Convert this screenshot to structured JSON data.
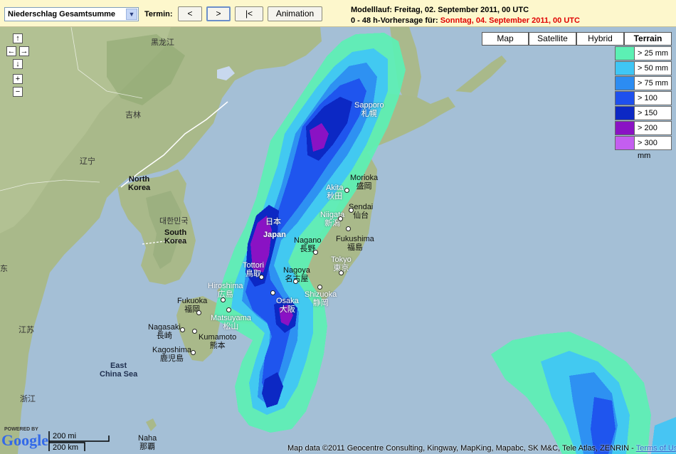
{
  "toolbar": {
    "parameter": "Niederschlag Gesamtsumme",
    "termin_label": "Termin:",
    "prev_label": "<",
    "next_label": ">",
    "first_label": "|<",
    "animation_label": "Animation",
    "modelllauf": "Modelllauf: Freitag, 02. September 2011, 00 UTC",
    "forecast_prefix": "0 - 48 h-Vorhersage für: ",
    "forecast_date": "Sonntag, 04. September 2011, 00 UTC"
  },
  "map_types": [
    "Map",
    "Satellite",
    "Hybrid",
    "Terrain"
  ],
  "active_map_type": "Terrain",
  "legend": [
    {
      "label": "> 25 mm",
      "color": "#5cf0b4"
    },
    {
      "label": "> 50 mm",
      "color": "#3fc6f5"
    },
    {
      "label": "> 75 mm",
      "color": "#2c8cf2"
    },
    {
      "label": "> 100 mm",
      "color": "#1e50ee"
    },
    {
      "label": "> 150 mm",
      "color": "#0c28c4"
    },
    {
      "label": "> 200 mm",
      "color": "#8a12c4"
    },
    {
      "label": "> 300 mm",
      "color": "#c45ef0"
    }
  ],
  "nav": {
    "up": "↑",
    "left": "←",
    "right": "→",
    "down": "↓",
    "zoom_in": "+",
    "zoom_out": "−"
  },
  "labels": {
    "heilongjiang": "黑龙江",
    "jilin": "吉林",
    "liaoning": "辽宁",
    "north_korea_1": "North",
    "north_korea_2": "Korea",
    "south_korea_native": "대한민국",
    "south_korea_1": "South",
    "south_korea_2": "Korea",
    "japan_native": "日本",
    "japan": "Japan",
    "east_china_sea_1": "East",
    "east_china_sea_2": "China Sea",
    "dong": "东",
    "jiangsu": "江苏",
    "zhejiang": "浙江",
    "sapporo": "Sapporo",
    "sapporo_native": "札幌",
    "morioka": "Morioka",
    "morioka_native": "盛岡",
    "akita": "Akita",
    "akita_native": "秋田",
    "sendai": "Sendai",
    "sendai_native": "仙台",
    "niigata": "Niigata",
    "niigata_native": "新潟",
    "fukushima": "Fukushima",
    "fukushima_native": "福島",
    "nagano": "Nagano",
    "nagano_native": "長野",
    "tokyo": "Tokyo",
    "tokyo_native": "東京",
    "tottori": "Tottori",
    "tottori_native": "鳥取",
    "nagoya": "Nagoya",
    "nagoya_native": "名古屋",
    "hiroshima": "Hiroshima",
    "hiroshima_native": "広島",
    "osaka": "Osaka",
    "osaka_native": "大阪",
    "shizuoka": "Shizuoka",
    "shizuoka_native": "静岡",
    "fukuoka": "Fukuoka",
    "fukuoka_native": "福岡",
    "matsuyama": "Matsuyama",
    "matsuyama_native": "松山",
    "nagasaki": "Nagasaki",
    "nagasaki_native": "長崎",
    "kumamoto": "Kumamoto",
    "kumamoto_native": "熊本",
    "kagoshima": "Kagoshima",
    "kagoshima_native": "鹿児島",
    "naha": "Naha",
    "naha_native": "那覇"
  },
  "scale": {
    "mi": "200 mi",
    "km": "200 km"
  },
  "google": {
    "powered_by": "POWERED BY",
    "logo": "Google"
  },
  "attribution": {
    "text": "Map data ©2011 Geocentre Consulting, Kingway, MapKing, Mapabc, SK M&C, Tele Atlas, ZENRIN - ",
    "terms": "Terms of Use"
  }
}
